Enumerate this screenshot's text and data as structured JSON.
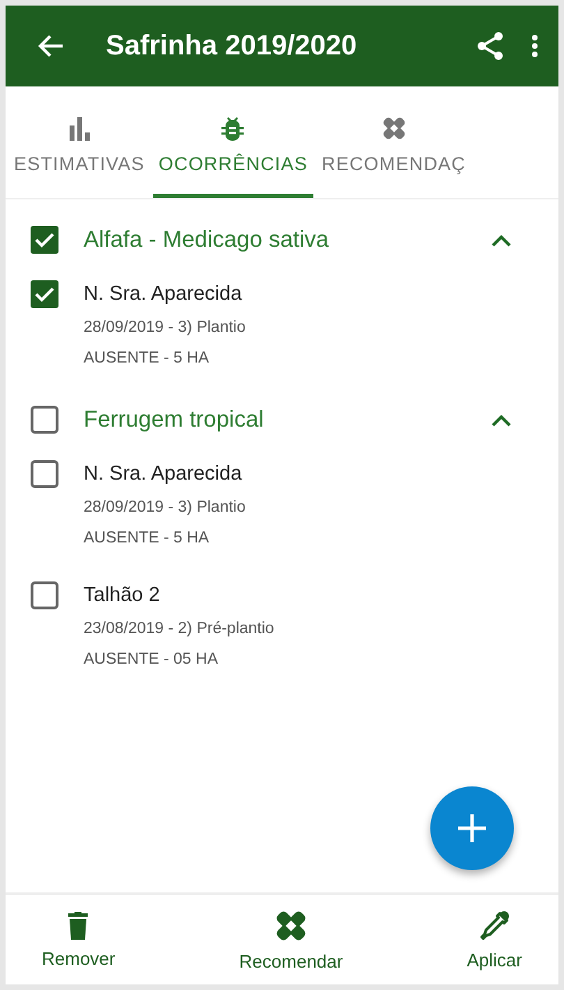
{
  "app_bar": {
    "title": "Safrinha 2019/2020"
  },
  "tabs": [
    {
      "label": "ESTIMATIVAS",
      "kind": "chart",
      "selected": false
    },
    {
      "label": "OCORRÊNCIAS",
      "kind": "bug",
      "selected": true
    },
    {
      "label": "RECOMENDAÇ",
      "kind": "bandage",
      "selected": false
    }
  ],
  "groups": [
    {
      "title": "Alfafa - Medicago sativa",
      "checked": true,
      "expanded": true,
      "items": [
        {
          "title": "N. Sra. Aparecida",
          "date": "28/09/2019 - 3) Plantio",
          "status": "AUSENTE - 5 HA",
          "checked": true
        }
      ]
    },
    {
      "title": "Ferrugem tropical",
      "checked": false,
      "expanded": true,
      "items": [
        {
          "title": "N. Sra. Aparecida",
          "date": "28/09/2019 - 3) Plantio",
          "status": "AUSENTE - 5 HA",
          "checked": false
        },
        {
          "title": "Talhão 2",
          "date": "23/08/2019 - 2) Pré-plantio",
          "status": "AUSENTE - 05 HA",
          "checked": false
        }
      ]
    }
  ],
  "bottom_actions": [
    {
      "label": "Remover",
      "kind": "trash"
    },
    {
      "label": "Recomendar",
      "kind": "bandage"
    },
    {
      "label": "Aplicar",
      "kind": "dropper"
    }
  ]
}
